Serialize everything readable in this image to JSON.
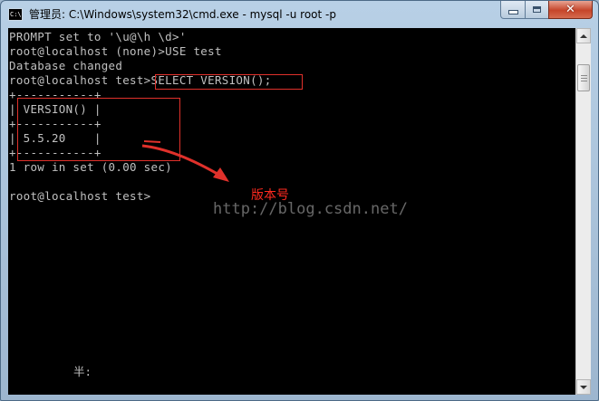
{
  "window": {
    "title": "管理员: C:\\Windows\\system32\\cmd.exe - mysql  -u root -p",
    "icon": "cmd-icon",
    "icon_text": "C:\\",
    "controls": {
      "minimize": "minimize-icon",
      "maximize": "maximize-icon",
      "close": "close-icon",
      "close_glyph": "✕"
    }
  },
  "console": {
    "lines": [
      "PROMPT set to '\\u@\\h \\d>'",
      "root@localhost (none)>USE test",
      "Database changed",
      "root@localhost test>SELECT VERSION();",
      "+-----------+",
      "| VERSION() |",
      "+-----------+",
      "| 5.5.20    |",
      "+-----------+",
      "1 row in set (0.00 sec)",
      "",
      "root@localhost test>"
    ],
    "ime_status": "半:"
  },
  "annotations": {
    "label": "版本号",
    "color": "#e0312b",
    "watermark": "http://blog.csdn.net/"
  },
  "colors": {
    "console_bg": "#000000",
    "console_fg": "#c0c0c0",
    "annotation": "#e0312b"
  }
}
